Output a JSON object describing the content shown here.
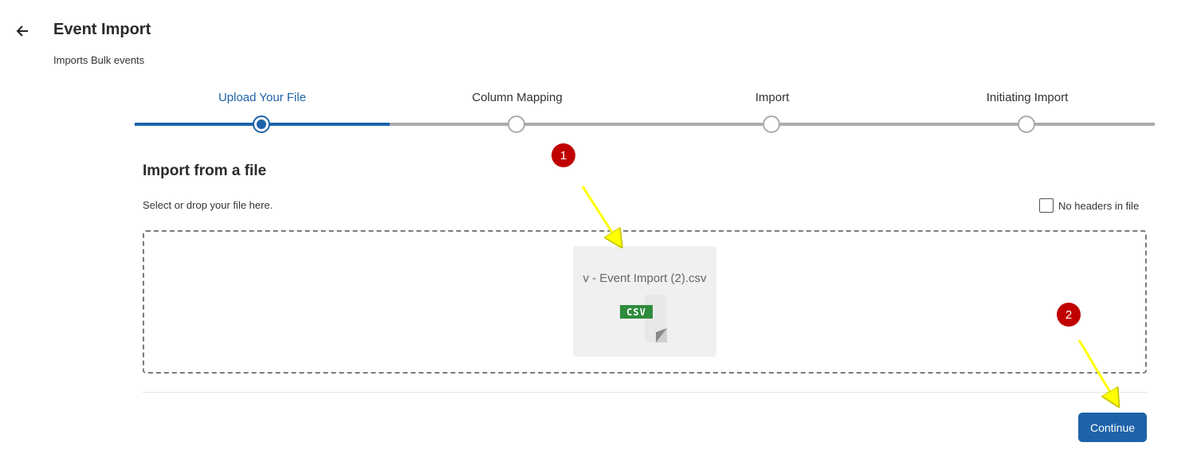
{
  "header": {
    "back_icon": "arrow-left-icon",
    "title": "Event Import",
    "subtitle": "Imports Bulk events"
  },
  "stepper": {
    "steps": [
      {
        "label": "Upload Your File",
        "active": true
      },
      {
        "label": "Column Mapping",
        "active": false
      },
      {
        "label": "Import",
        "active": false
      },
      {
        "label": "Initiating Import",
        "active": false
      }
    ],
    "progress_percent": 25
  },
  "import_section": {
    "title": "Import from a file",
    "hint": "Select or drop your file here.",
    "no_headers_label": "No headers in file",
    "no_headers_checked": false
  },
  "file": {
    "name": "v - Event Import (2).csv",
    "icon": "csv-file-icon",
    "badge_text": "CSV"
  },
  "footer": {
    "continue_label": "Continue"
  },
  "annotations": [
    {
      "number": "1"
    },
    {
      "number": "2"
    }
  ],
  "colors": {
    "accent": "#1e63a9",
    "track": "#a9abae",
    "annotation_badge": "#c00000",
    "annotation_arrow": "#ffff00",
    "csv_tag": "#2e8b3e"
  }
}
